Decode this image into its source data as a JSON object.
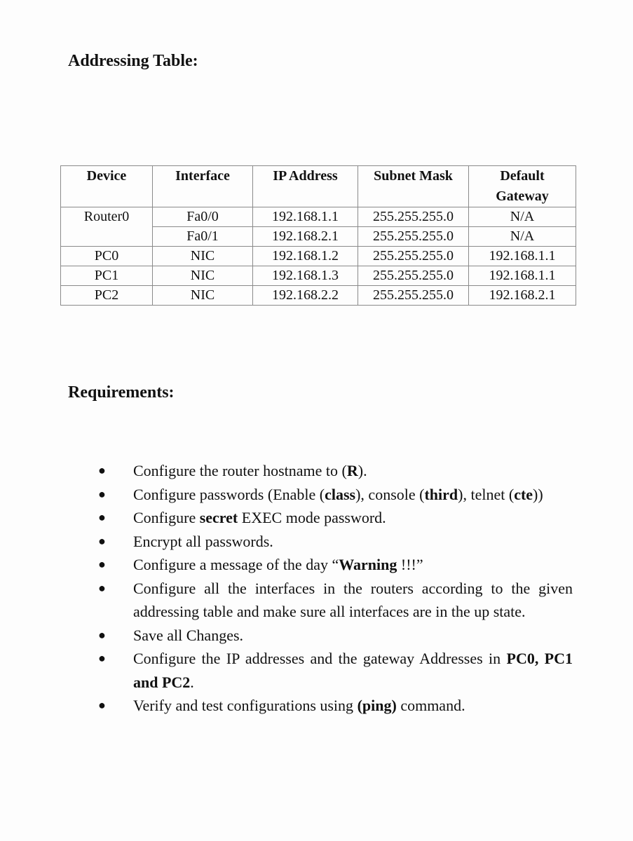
{
  "headings": {
    "addressing": "Addressing Table:",
    "requirements": "Requirements:"
  },
  "table": {
    "headers": [
      "Device",
      "Interface",
      "IP Address",
      "Subnet Mask",
      "Default Gateway"
    ],
    "rows": [
      {
        "device": "Router0",
        "interface": "Fa0/0",
        "ip": "192.168.1.1",
        "mask": "255.255.255.0",
        "gateway": "N/A"
      },
      {
        "device": "",
        "interface": "Fa0/1",
        "ip": "192.168.2.1",
        "mask": "255.255.255.0",
        "gateway": "N/A"
      },
      {
        "device": "PC0",
        "interface": "NIC",
        "ip": "192.168.1.2",
        "mask": "255.255.255.0",
        "gateway": "192.168.1.1"
      },
      {
        "device": "PC1",
        "interface": "NIC",
        "ip": "192.168.1.3",
        "mask": "255.255.255.0",
        "gateway": "192.168.1.1"
      },
      {
        "device": "PC2",
        "interface": "NIC",
        "ip": "192.168.2.2",
        "mask": "255.255.255.0",
        "gateway": "192.168.2.1"
      }
    ]
  },
  "requirements": [
    {
      "parts": [
        {
          "t": "Configure the router hostname to ("
        },
        {
          "t": "R",
          "b": true
        },
        {
          "t": ")."
        }
      ]
    },
    {
      "parts": [
        {
          "t": "Configure passwords (Enable ("
        },
        {
          "t": "class",
          "b": true
        },
        {
          "t": "), console ("
        },
        {
          "t": "third",
          "b": true
        },
        {
          "t": "), telnet ("
        },
        {
          "t": "cte",
          "b": true
        },
        {
          "t": "))"
        }
      ]
    },
    {
      "parts": [
        {
          "t": "Configure "
        },
        {
          "t": "secret",
          "b": true
        },
        {
          "t": " EXEC mode password."
        }
      ]
    },
    {
      "parts": [
        {
          "t": "Encrypt all passwords."
        }
      ]
    },
    {
      "parts": [
        {
          "t": "Configure a message of the day “"
        },
        {
          "t": "Warning",
          "b": true
        },
        {
          "t": " !!!”"
        }
      ]
    },
    {
      "parts": [
        {
          "t": "Configure all the interfaces in the routers according to the given addressing table and make sure all interfaces are in the up state."
        }
      ]
    },
    {
      "parts": [
        {
          "t": "Save all Changes."
        }
      ]
    },
    {
      "parts": [
        {
          "t": "Configure the IP addresses and the gateway Addresses in "
        },
        {
          "t": "PC0, PC1 and PC2",
          "b": true
        },
        {
          "t": "."
        }
      ]
    },
    {
      "parts": [
        {
          "t": "Verify and test configurations using "
        },
        {
          "t": "(ping)",
          "b": true
        },
        {
          "t": " command."
        }
      ]
    }
  ],
  "bullet_glyph": "●"
}
